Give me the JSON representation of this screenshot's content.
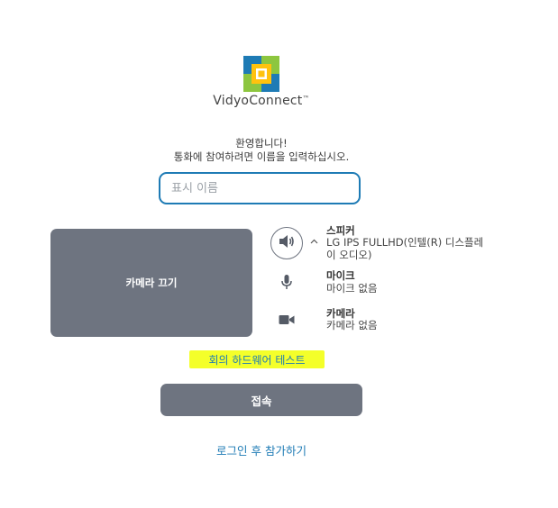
{
  "brand": {
    "name": "VidyoConnect",
    "trademark": "™"
  },
  "welcome": {
    "line1": "환영합니다!",
    "line2": "통화에 참여하려면 이름을 입력하십시오."
  },
  "name_input": {
    "placeholder": "표시 이름",
    "value": ""
  },
  "camera_preview": {
    "label": "카메라 끄기"
  },
  "devices": {
    "speaker": {
      "title": "스피커",
      "value": "LG IPS FULLHD(인텔(R) 디스플레이 오디오)"
    },
    "microphone": {
      "title": "마이크",
      "value": "마이크 없음"
    },
    "camera": {
      "title": "카메라",
      "value": "카메라 없음"
    }
  },
  "hardware_test_link": "회의 하드웨어 테스트",
  "connect_button": "접속",
  "login_link": "로그인 후 참가하기",
  "colors": {
    "accent": "#1e7bb5",
    "button_gray": "#6e7480",
    "highlight": "#f4ff2a",
    "logo_blue": "#1e7bb5",
    "logo_green": "#8dc63f",
    "logo_yellow": "#ffc20e"
  },
  "icons": {
    "speaker": "speaker-icon",
    "chevron": "chevron-up-icon",
    "microphone": "microphone-icon",
    "camera": "video-camera-icon"
  }
}
